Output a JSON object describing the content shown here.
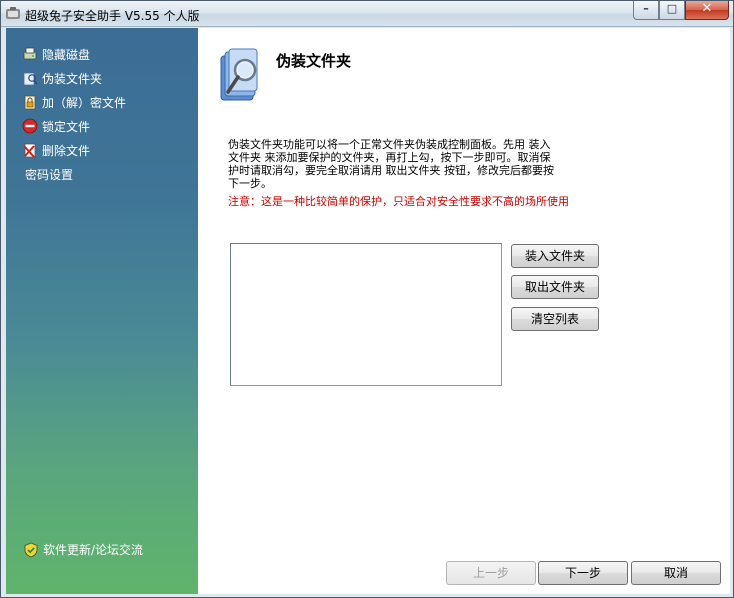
{
  "window": {
    "title": "超级兔子安全助手 V5.55 个人版",
    "controls": {
      "minimize": "–",
      "maximize": "□",
      "close": "✕"
    }
  },
  "sidebar": {
    "items": [
      {
        "label": "隐藏磁盘",
        "icon": "hidden-disk-icon"
      },
      {
        "label": "伪装文件夹",
        "icon": "disguise-folder-icon"
      },
      {
        "label": "加（解）密文件",
        "icon": "encrypt-file-icon"
      },
      {
        "label": "锁定文件",
        "icon": "lock-file-icon"
      },
      {
        "label": "删除文件",
        "icon": "delete-file-icon"
      },
      {
        "label": "密码设置",
        "icon": null
      }
    ],
    "update_link": {
      "label": "软件更新/论坛交流",
      "icon": "shield-icon"
    }
  },
  "main": {
    "title": "伪装文件夹",
    "description": "伪装文件夹功能可以将一个正常文件夹伪装成控制面板。先用 装入文件夹 来添加要保护的文件夹，再打上勾，按下一步即可。取消保护时请取消勾，要完全取消请用  取出文件夹  按钮，修改完后都要按下一步。",
    "warning": "注意：这是一种比较简单的保护，只适合对安全性要求不高的场所使用",
    "list_items": [],
    "buttons": {
      "load_folder": "装入文件夹",
      "remove_folder": "取出文件夹",
      "clear_list": "清空列表"
    }
  },
  "footer": {
    "prev": "上一步",
    "next": "下一步",
    "cancel": "取消"
  },
  "colors": {
    "sidebar_top": "#3c6d95",
    "sidebar_bottom": "#5fb46b",
    "warning_text": "#cc0000"
  }
}
